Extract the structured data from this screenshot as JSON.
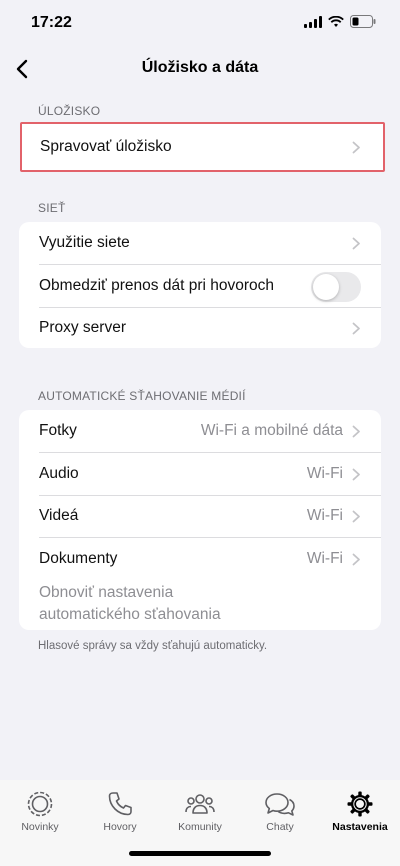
{
  "status": {
    "time": "17:22"
  },
  "header": {
    "title": "Úložisko a dáta"
  },
  "sections": {
    "storage": {
      "header": "ÚLOŽISKO",
      "manage_label": "Spravovať úložisko"
    },
    "network": {
      "header": "SIEŤ",
      "usage_label": "Využitie siete",
      "limit_label": "Obmedziť prenos dát pri hovoroch",
      "limit_enabled": false,
      "proxy_label": "Proxy server"
    },
    "auto_download": {
      "header": "AUTOMATICKÉ SŤAHOVANIE MÉDIÍ",
      "photos_label": "Fotky",
      "photos_value": "Wi-Fi a mobilné dáta",
      "audio_label": "Audio",
      "audio_value": "Wi-Fi",
      "video_label": "Videá",
      "video_value": "Wi-Fi",
      "docs_label": "Dokumenty",
      "docs_value": "Wi-Fi",
      "reset_line1": "Obnoviť nastavenia",
      "reset_line2": "automatického sťahovania",
      "footnote": "Hlasové správy sa vždy sťahujú automaticky."
    }
  },
  "tabs": {
    "updates": "Novinky",
    "calls": "Hovory",
    "communities": "Komunity",
    "chats": "Chaty",
    "settings": "Nastavenia"
  },
  "colors": {
    "background": "#f2f2f7",
    "highlight": "#e2626a",
    "secondary_text": "#8e8e93"
  }
}
